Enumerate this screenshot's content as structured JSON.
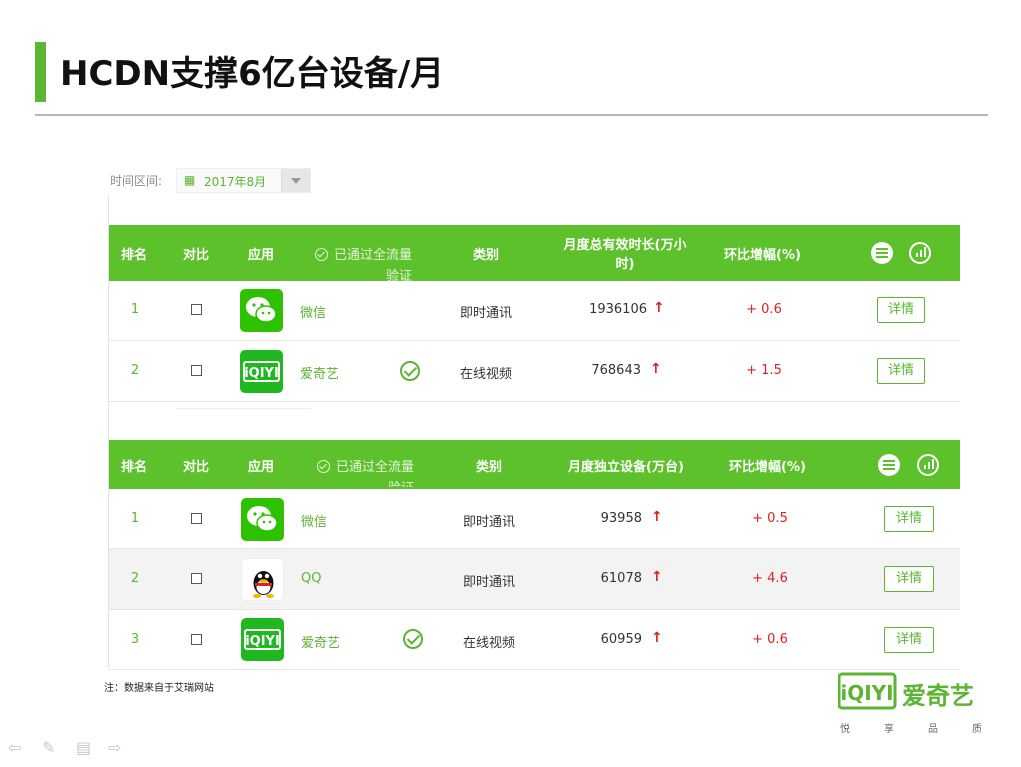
{
  "slide": {
    "title": "HCDN支撑6亿台设备/月",
    "note": "注：数据来自于艾瑞网站"
  },
  "filter": {
    "label": "时间区间:",
    "selected": "2017年8月"
  },
  "table1": {
    "headers": {
      "rank": "排名",
      "compare": "对比",
      "app": "应用",
      "verified_line1": "已通过全流量",
      "verified_line2": "验证",
      "category": "类别",
      "metric_line1": "月度总有效时长(万小",
      "metric_line2": "时)",
      "change": "环比增幅(%)"
    },
    "rows": [
      {
        "rank": "1",
        "app": "微信",
        "logo": "wechat-logo",
        "verified": false,
        "category": "即时通讯",
        "value": "1936106",
        "change": "+ 0.6",
        "detail": "详情"
      },
      {
        "rank": "2",
        "app": "爱奇艺",
        "logo": "iqiyi-logo",
        "verified": true,
        "category": "在线视频",
        "value": "768643",
        "change": "+ 1.5",
        "detail": "详情"
      }
    ]
  },
  "table2": {
    "headers": {
      "rank": "排名",
      "compare": "对比",
      "app": "应用",
      "verified_line1": "已通过全流量",
      "verified_line2": "验证",
      "category": "类别",
      "metric": "月度独立设备(万台)",
      "change": "环比增幅(%)"
    },
    "rows": [
      {
        "rank": "1",
        "app": "微信",
        "logo": "wechat-logo",
        "verified": false,
        "category": "即时通讯",
        "value": "93958",
        "change": "+ 0.5",
        "detail": "详情"
      },
      {
        "rank": "2",
        "app": "QQ",
        "logo": "qq-logo",
        "verified": false,
        "category": "即时通讯",
        "value": "61078",
        "change": "+ 4.6",
        "detail": "详情"
      },
      {
        "rank": "3",
        "app": "爱奇艺",
        "logo": "iqiyi-logo",
        "verified": true,
        "category": "在线视频",
        "value": "60959",
        "change": "+ 0.6",
        "detail": "详情"
      }
    ]
  },
  "brand": {
    "logo_text": "iQIYI",
    "name": "爱奇艺",
    "slogan": "悦享品质"
  },
  "colors": {
    "accent": "#5cc12a",
    "title_bar": "#5cb531",
    "up": "#e02020"
  },
  "icons": {
    "up_arrow": "↑",
    "calendar": "▦"
  }
}
